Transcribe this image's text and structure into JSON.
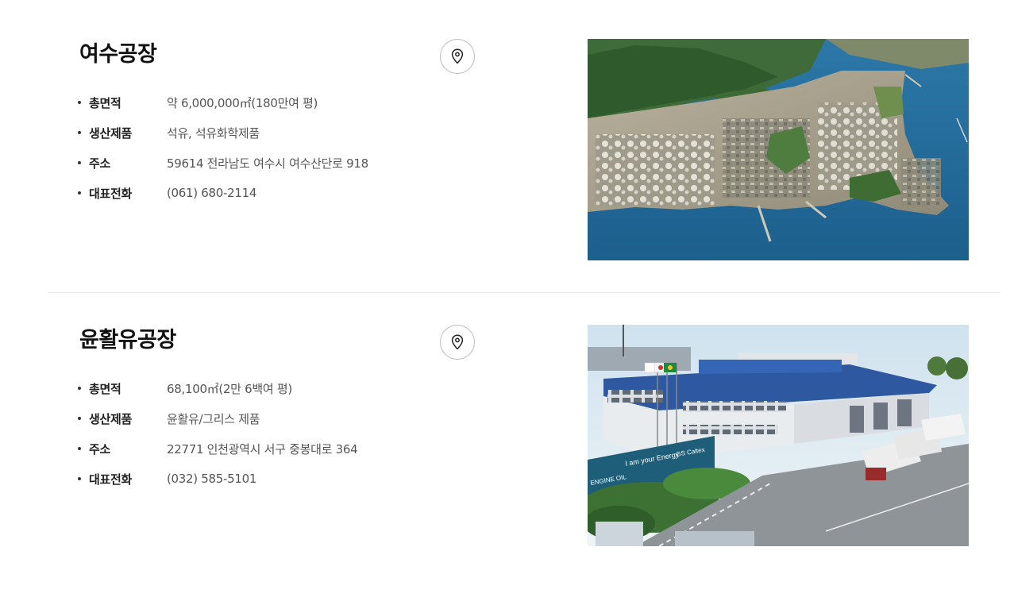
{
  "plants": [
    {
      "name": "여수공장",
      "rows": [
        {
          "label": "총면적",
          "value": "약 6,000,000㎡(180만여 평)"
        },
        {
          "label": "생산제품",
          "value": "석유, 석유화학제품"
        },
        {
          "label": "주소",
          "value": "59614 전라남도 여수시 여수산단로 918"
        },
        {
          "label": "대표전화",
          "value": "(061) 680-2114"
        }
      ]
    },
    {
      "name": "윤활유공장",
      "rows": [
        {
          "label": "총면적",
          "value": "68,100㎡(2만 6백여 평)"
        },
        {
          "label": "생산제품",
          "value": "윤활유/그리스 제품"
        },
        {
          "label": "주소",
          "value": "22771 인천광역시 서구 중봉대로 364"
        },
        {
          "label": "대표전화",
          "value": "(032) 585-5101"
        }
      ]
    }
  ],
  "photo2_signs": {
    "sign1": "ENGINE OIL",
    "sign2": "I am your Energy",
    "sign3": "GS Caltex"
  },
  "icons": {
    "map_button": "map-pin-icon"
  }
}
